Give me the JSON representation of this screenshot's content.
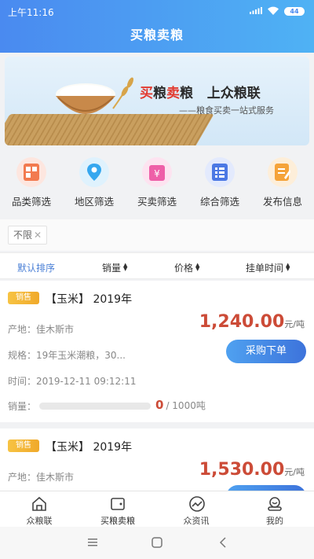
{
  "status": {
    "time": "上午11:16",
    "battery": "44"
  },
  "header": {
    "title": "买粮卖粮"
  },
  "banner": {
    "title_red1": "买",
    "title_black1": "粮",
    "title_red2": "卖",
    "title_black2": "粮",
    "title_rest": "上众粮联",
    "subtitle": "——粮食买卖一站式服务"
  },
  "categories": [
    {
      "label": "品类筛选",
      "icon": "category-icon",
      "color": "#f27a4f",
      "bg": "#fde6df"
    },
    {
      "label": "地区筛选",
      "icon": "location-icon",
      "color": "#35a7ef",
      "bg": "#dff2fd"
    },
    {
      "label": "买卖筛选",
      "icon": "yen-icon",
      "color": "#ee5fa8",
      "bg": "#fde3f0"
    },
    {
      "label": "综合筛选",
      "icon": "list-icon",
      "color": "#4b78e4",
      "bg": "#e3eafd"
    },
    {
      "label": "发布信息",
      "icon": "publish-icon",
      "color": "#f5a33a",
      "bg": "#fdeed9"
    }
  ],
  "filter_chip": {
    "label": "不限",
    "close": "✕"
  },
  "sort": {
    "default": "默认排序",
    "sales": "销量",
    "price": "价格",
    "time": "挂单时间"
  },
  "listings": [
    {
      "tag": "销售",
      "name": "【玉米】 2019年",
      "origin_label": "产地：",
      "origin": "佳木斯市",
      "spec_label": "规格：",
      "spec": "19年玉米潮粮，30...",
      "time_label": "时间：",
      "time": "2019-12-11 09:12:11",
      "price": "1,240.00",
      "unit": "元/吨",
      "buy_label": "采购下单",
      "sold_label": "销量：",
      "sold": "0",
      "total": "/ 1000吨",
      "sold_fraction": 0
    },
    {
      "tag": "销售",
      "name": "【玉米】 2019年",
      "origin_label": "产地：",
      "origin": "佳木斯市",
      "price": "1,530.00",
      "unit": "元/吨"
    }
  ],
  "tabs": [
    {
      "label": "众粮联",
      "icon": "home-icon"
    },
    {
      "label": "买粮卖粮",
      "icon": "wallet-icon"
    },
    {
      "label": "众资讯",
      "icon": "trend-icon"
    },
    {
      "label": "我的",
      "icon": "profile-icon"
    }
  ],
  "colors": {
    "accent": "#4a8af0",
    "price": "#cc4b37",
    "tag": "#f0a92a"
  }
}
